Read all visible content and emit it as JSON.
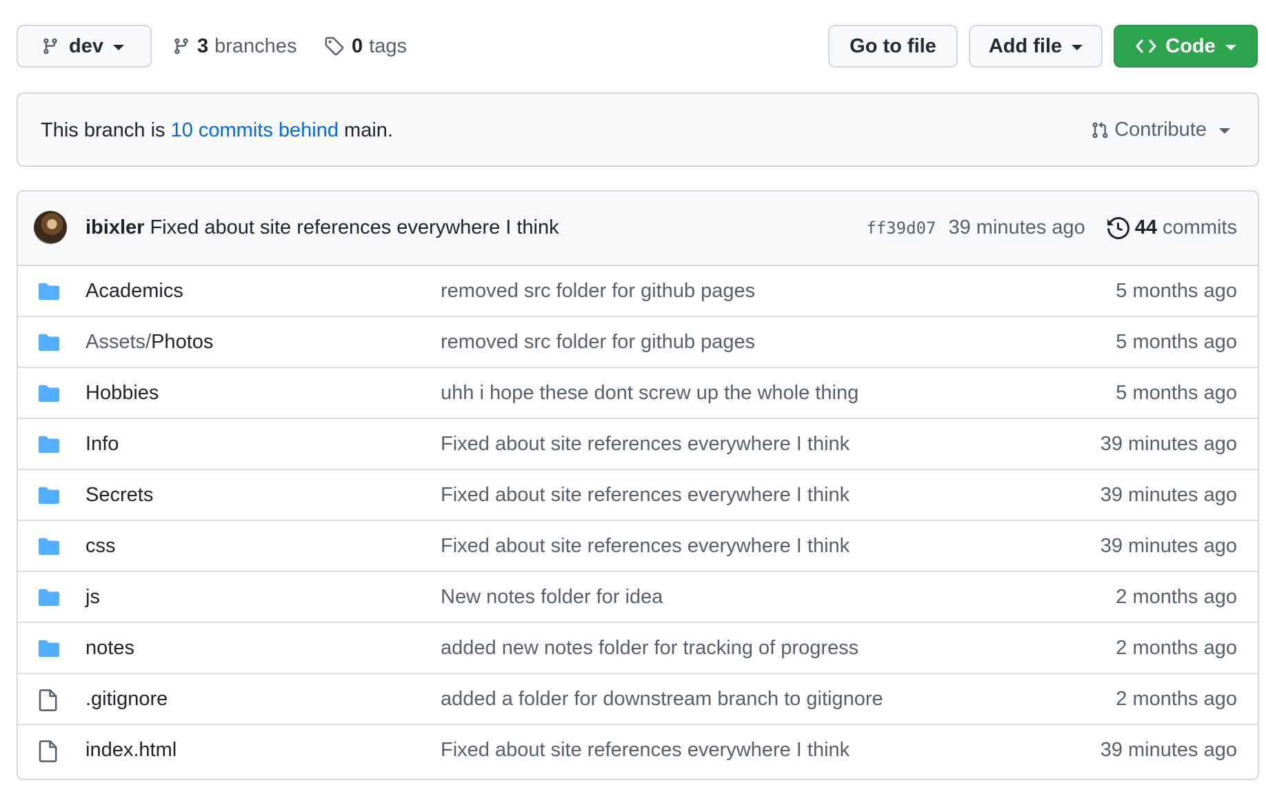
{
  "toolbar": {
    "branch": "dev",
    "branches_count": "3",
    "branches_label": "branches",
    "tags_count": "0",
    "tags_label": "tags",
    "goto_file": "Go to file",
    "add_file": "Add file",
    "code": "Code"
  },
  "banner": {
    "prefix": "This branch is",
    "link": "10 commits behind",
    "suffix": "main.",
    "contribute": "Contribute"
  },
  "commit": {
    "author": "ibixler",
    "message": "Fixed about site references everywhere I think",
    "sha": "ff39d07",
    "age": "39 minutes ago",
    "commits_count": "44",
    "commits_label": "commits"
  },
  "files": [
    {
      "type": "folder",
      "prefix": "",
      "name": "Academics",
      "message": "removed src folder for github pages",
      "age": "5 months ago"
    },
    {
      "type": "folder",
      "prefix": "Assets/",
      "name": "Photos",
      "message": "removed src folder for github pages",
      "age": "5 months ago"
    },
    {
      "type": "folder",
      "prefix": "",
      "name": "Hobbies",
      "message": "uhh i hope these dont screw up the whole thing",
      "age": "5 months ago"
    },
    {
      "type": "folder",
      "prefix": "",
      "name": "Info",
      "message": "Fixed about site references everywhere I think",
      "age": "39 minutes ago"
    },
    {
      "type": "folder",
      "prefix": "",
      "name": "Secrets",
      "message": "Fixed about site references everywhere I think",
      "age": "39 minutes ago"
    },
    {
      "type": "folder",
      "prefix": "",
      "name": "css",
      "message": "Fixed about site references everywhere I think",
      "age": "39 minutes ago"
    },
    {
      "type": "folder",
      "prefix": "",
      "name": "js",
      "message": "New notes folder for idea",
      "age": "2 months ago"
    },
    {
      "type": "folder",
      "prefix": "",
      "name": "notes",
      "message": "added new notes folder for tracking of progress",
      "age": "2 months ago"
    },
    {
      "type": "file",
      "prefix": "",
      "name": ".gitignore",
      "message": "added a folder for downstream branch to gitignore",
      "age": "2 months ago"
    },
    {
      "type": "file",
      "prefix": "",
      "name": "index.html",
      "message": "Fixed about site references everywhere I think",
      "age": "39 minutes ago"
    }
  ],
  "colors": {
    "folder": "#54aeff",
    "file": "#57606a",
    "code_button": "#2da44e",
    "link": "#0969da"
  }
}
